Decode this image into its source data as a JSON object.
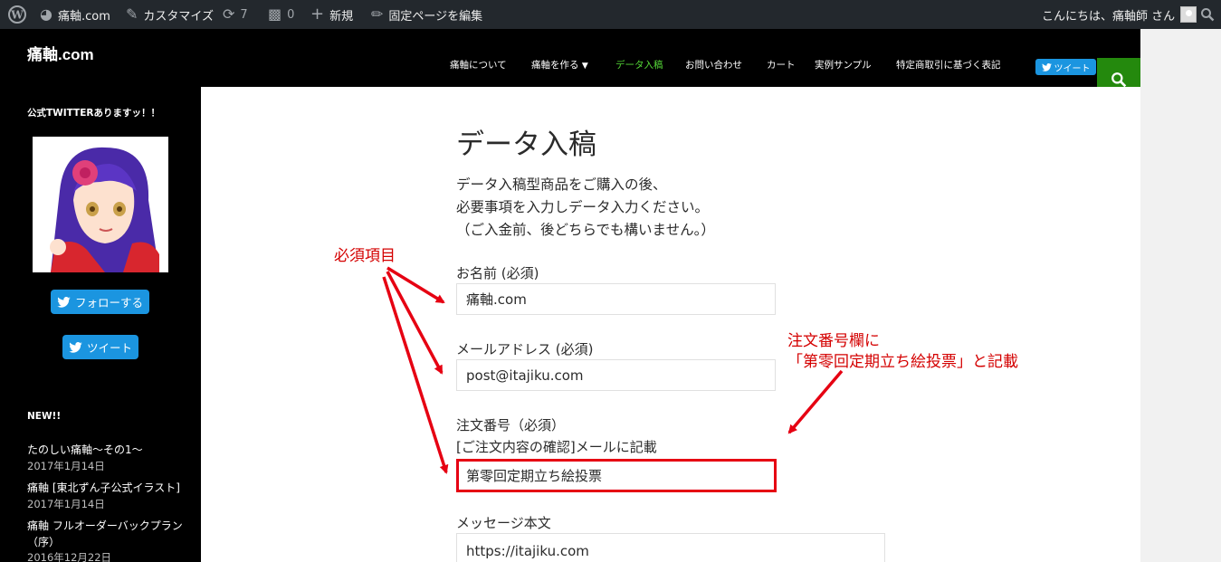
{
  "adminbar": {
    "site": "痛軸.com",
    "customize": "カスタマイズ",
    "updates": "7",
    "comments": "0",
    "new": "新規",
    "edit": "固定ページを編集",
    "greeting": "こんにちは、痛軸師 さん"
  },
  "header": {
    "title": "痛軸.com",
    "tweet": "ツイート",
    "nav": [
      "痛軸について",
      "痛軸を作る",
      "データ入稿",
      "お問い合わせ",
      "カート",
      "実例サンプル",
      "特定商取引に基づく表記"
    ]
  },
  "sidebar": {
    "twitter_heading": "公式TWITTERありますッ！！",
    "follow": "フォローする",
    "tweet": "ツイート",
    "new_heading": "NEW!!",
    "posts": [
      {
        "title": "たのしい痛軸〜その1〜",
        "date": "2017年1月14日"
      },
      {
        "title": "痛軸 [東北ずん子公式イラスト]",
        "date": "2017年1月14日"
      },
      {
        "title": "痛軸 フルオーダーバックプラン",
        "title2": "（序）",
        "date": "2016年12月22日"
      }
    ]
  },
  "main": {
    "title": "データ入稿",
    "intro": [
      "データ入稿型商品をご購入の後、",
      "必要事項を入力しデータ入力ください。",
      "（ご入金前、後どちらでも構いません。）"
    ],
    "name_label": "お名前 (必須)",
    "name_value": "痛軸.com",
    "email_label": "メールアドレス (必須)",
    "email_value": "post@itajiku.com",
    "order_label": "注文番号（必須）",
    "order_note": "[ご注文内容の確認]メールに記載",
    "order_value": "第零回定期立ち絵投票",
    "message_label": "メッセージ本文",
    "message_value": "https://itajiku.com"
  },
  "annotations": {
    "required": "必須項目",
    "order_note_line1": "注文番号欄に",
    "order_note_line2": "「第零回定期立ち絵投票」と記載"
  },
  "colors": {
    "accent_green": "#55d737",
    "search_green": "#24890d",
    "twitter_blue": "#1b95e0",
    "annotation_red": "#e60012"
  }
}
